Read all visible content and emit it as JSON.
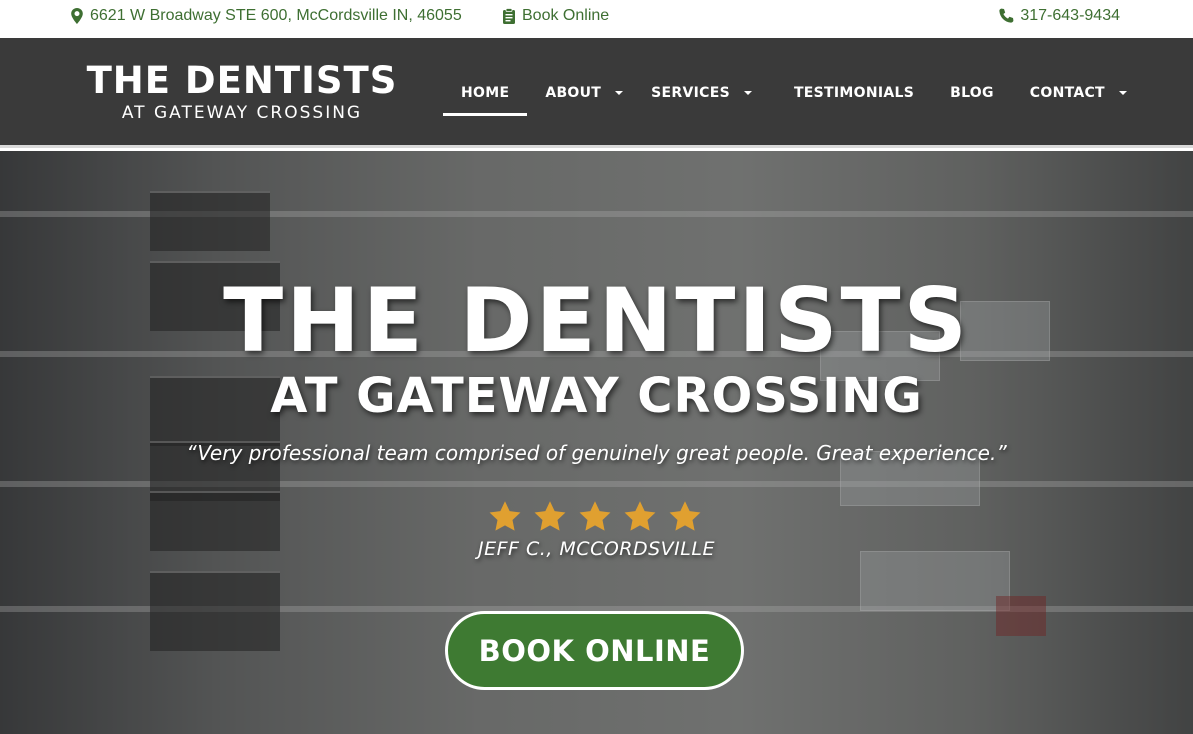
{
  "topbar": {
    "address": "6621 W Broadway STE 600, McCordsville IN, 46055",
    "book_online": "Book Online",
    "phone": "317-643-9434",
    "icons": {
      "address": "map-marker-icon",
      "book": "clipboard-icon",
      "phone": "phone-icon"
    }
  },
  "logo": {
    "line1": "THE DENTISTS",
    "line2": "AT GATEWAY CROSSING"
  },
  "nav": {
    "items": [
      {
        "label": "HOME",
        "active": true,
        "dropdown": false
      },
      {
        "label": "ABOUT",
        "active": false,
        "dropdown": true
      },
      {
        "label": "SERVICES",
        "active": false,
        "dropdown": true
      },
      {
        "label": "TESTIMONIALS",
        "active": false,
        "dropdown": false
      },
      {
        "label": "BLOG",
        "active": false,
        "dropdown": false
      },
      {
        "label": "CONTACT",
        "active": false,
        "dropdown": true
      }
    ]
  },
  "hero": {
    "title": "THE DENTISTS",
    "subtitle": "AT GATEWAY CROSSING",
    "quote": "“Very professional team comprised of genuinely great people. Great experience.”",
    "rating": 5,
    "reviewer": "JEFF C., MCCORDSVILLE",
    "cta": "BOOK ONLINE"
  },
  "colors": {
    "accent_green": "#3e7a32",
    "link_green": "#3e6f32",
    "header_bg": "#3a3a3a",
    "star_gold": "#e0a030"
  }
}
